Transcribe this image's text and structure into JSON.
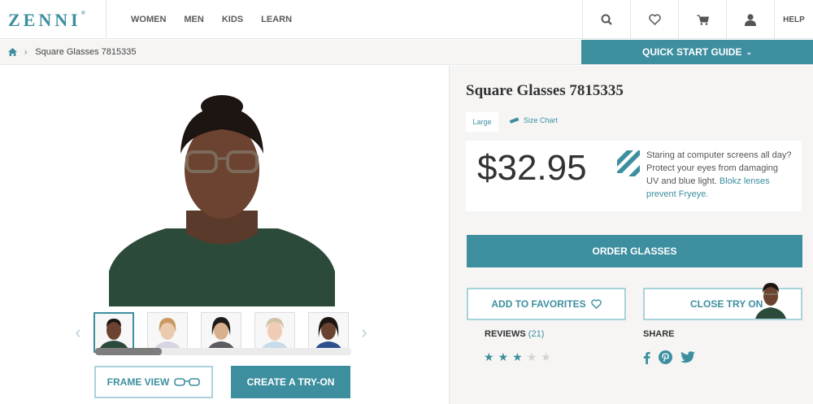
{
  "brand": {
    "logo": "ZENNI",
    "accent": "#3d8fa0"
  },
  "nav": {
    "items": [
      "WOMEN",
      "MEN",
      "KIDS",
      "LEARN"
    ]
  },
  "header_icons": [
    "search-icon",
    "heart-icon",
    "cart-icon",
    "account-icon"
  ],
  "header_help": "HELP",
  "breadcrumb": {
    "current": "Square Glasses 7815335"
  },
  "quick_start": "QUICK START GUIDE",
  "product": {
    "title": "Square Glasses 7815335",
    "size": "Large",
    "size_chart": "Size Chart",
    "price": "$32.95",
    "promo_text": "Staring at computer screens all day? Protect your eyes from damaging UV and blue light.",
    "promo_link": "Blokz lenses prevent Fryeye."
  },
  "buttons": {
    "frame_view": "FRAME VIEW",
    "create_tryon": "CREATE A TRY-ON",
    "order": "ORDER GLASSES",
    "add_favorites": "ADD TO FAVORITES",
    "close_tryon": "CLOSE TRY ON"
  },
  "reviews": {
    "label": "REVIEWS",
    "count": "(21)",
    "rating": 3,
    "max": 5
  },
  "share": {
    "label": "SHARE",
    "networks": [
      "facebook-icon",
      "pinterest-icon",
      "twitter-icon"
    ]
  },
  "thumbnails": {
    "count": 5,
    "selected": 0
  }
}
